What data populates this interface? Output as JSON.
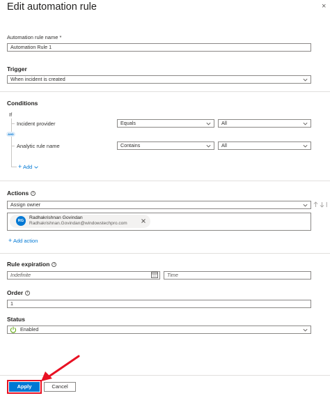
{
  "panel": {
    "title": "Edit automation rule",
    "close_glyph": "×"
  },
  "rule_name": {
    "label": "Automation rule name *",
    "value": "Automation Rule 1"
  },
  "trigger": {
    "heading": "Trigger",
    "selected": "When incident is created"
  },
  "conditions": {
    "heading": "Conditions",
    "if_label": "If",
    "and_badge": "AND",
    "rows": [
      {
        "property": "Incident provider",
        "operator": "Equals",
        "value": "All"
      },
      {
        "property": "Analytic rule name",
        "operator": "Contains",
        "value": "All"
      }
    ],
    "add_label": "Add"
  },
  "actions": {
    "heading": "Actions",
    "selected": "Assign owner",
    "owner": {
      "initials": "RG",
      "name": "Radhakrishnan Govindan",
      "email": "Radhakrishnan.Govindan@windowstechpro.com",
      "avatar_color": "#0078d4"
    },
    "add_action_label": "Add action"
  },
  "expiration": {
    "heading": "Rule expiration",
    "date_placeholder": "Indefinite",
    "time_placeholder": "Time"
  },
  "order": {
    "heading": "Order",
    "value": "1"
  },
  "status": {
    "heading": "Status",
    "selected": "Enabled",
    "status_color": "#57a300"
  },
  "footer": {
    "apply_label": "Apply",
    "cancel_label": "Cancel",
    "highlight_color": "#e81123"
  }
}
